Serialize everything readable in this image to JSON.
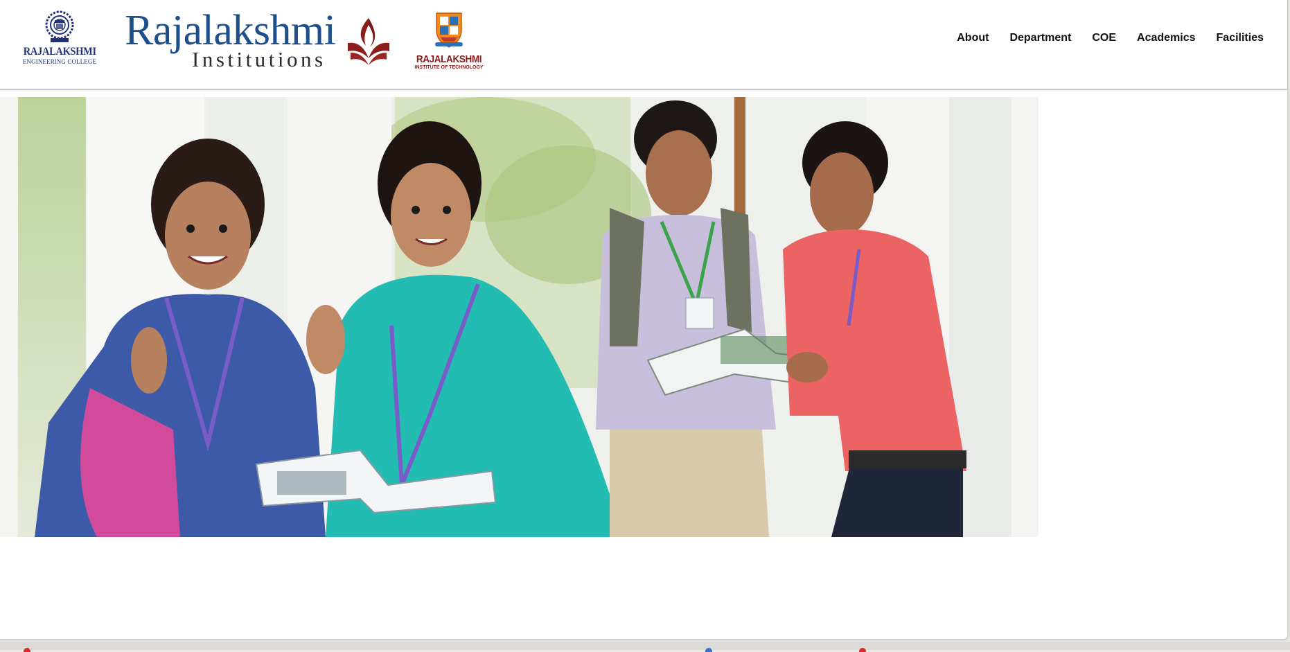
{
  "header": {
    "rec_logo": {
      "name": "RAJALAKSHMI",
      "subtitle": "ENGINEERING COLLEGE"
    },
    "institutions_logo": {
      "title": "Rajalakshmi",
      "subtitle": "Institutions"
    },
    "rit_logo": {
      "name": "RAJALAKSHMI",
      "subtitle": "INSTITUTE OF TECHNOLOGY"
    }
  },
  "nav": {
    "items": [
      {
        "label": "About"
      },
      {
        "label": "Department"
      },
      {
        "label": "COE"
      },
      {
        "label": "Academics"
      },
      {
        "label": "Facilities"
      }
    ]
  },
  "hero": {
    "image": "students-campus-photo"
  },
  "colors": {
    "brand_blue": "#1d4f8c",
    "brand_maroon": "#8a1b1b",
    "nav_text": "#111111"
  }
}
